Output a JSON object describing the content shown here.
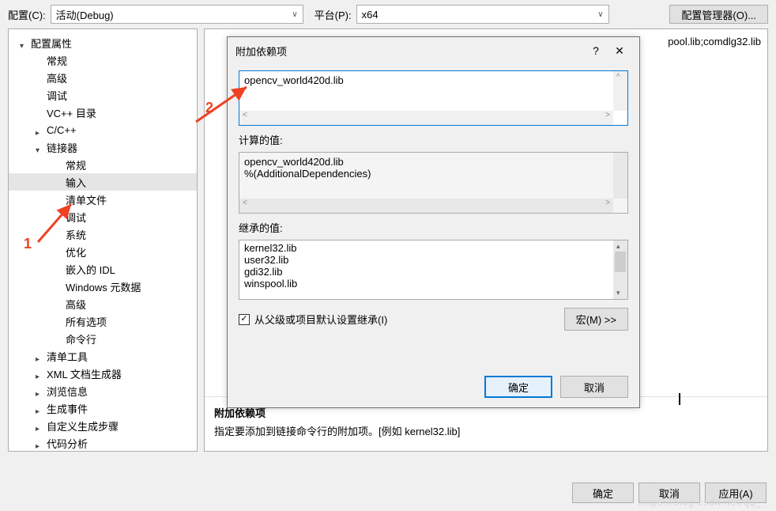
{
  "top": {
    "config_label": "配置(C):",
    "config_value": "活动(Debug)",
    "platform_label": "平台(P):",
    "platform_value": "x64",
    "manager_btn": "配置管理器(O)..."
  },
  "tree": {
    "root": "配置属性",
    "items_before_linker": [
      "常规",
      "高级",
      "调试",
      "VC++ 目录"
    ],
    "cpp": "C/C++",
    "linker": "链接器",
    "linker_children": [
      "常规",
      "输入",
      "清单文件",
      "调试",
      "系统",
      "优化",
      "嵌入的 IDL",
      "Windows 元数据",
      "高级",
      "所有选项",
      "命令行"
    ],
    "after_linker": [
      "清单工具",
      "XML 文档生成器",
      "浏览信息",
      "生成事件",
      "自定义生成步骤",
      "代码分析"
    ]
  },
  "right": {
    "shown_deps": "pool.lib;comdlg32.lib",
    "desc_title": "附加依赖项",
    "desc_text": "指定要添加到链接命令行的附加项。[例如 kernel32.lib]"
  },
  "bottom": {
    "ok": "确定",
    "cancel": "取消",
    "apply": "应用(A)"
  },
  "dialog": {
    "title": "附加依赖项",
    "edit_value": "opencv_world420d.lib",
    "computed_label": "计算的值:",
    "computed_lines": [
      "opencv_world420d.lib",
      "%(AdditionalDependencies)"
    ],
    "inherited_label": "继承的值:",
    "inherited_lines": [
      "kernel32.lib",
      "user32.lib",
      "gdi32.lib",
      "winspool.lib"
    ],
    "inherit_chk": "从父级或项目默认设置继承(I)",
    "macro_btn": "宏(M) >>",
    "ok": "确定",
    "cancel": "取消"
  },
  "annotations": {
    "a1": "1",
    "a2": "2"
  },
  "watermark": "https://blog.csdn.net/qq_"
}
